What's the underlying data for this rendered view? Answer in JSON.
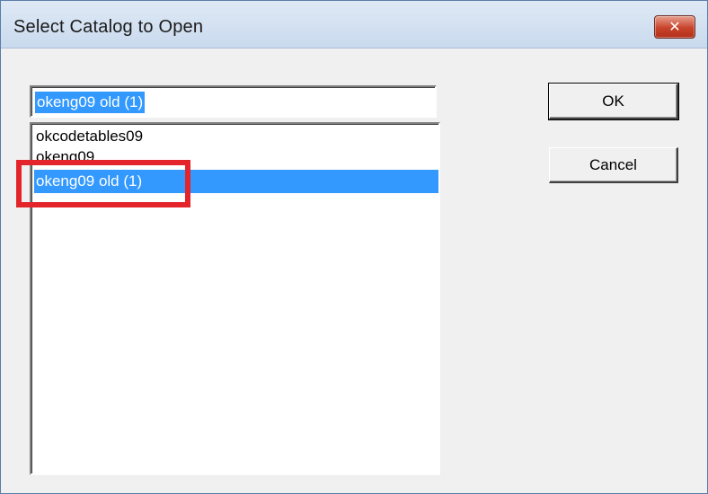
{
  "window": {
    "title": "Select Catalog to Open",
    "close_glyph": "✕"
  },
  "edit": {
    "value": "okeng09 old (1)"
  },
  "list": {
    "items": [
      {
        "label": "okcodetables09",
        "selected": false
      },
      {
        "label": "okeng09",
        "selected": false
      },
      {
        "label": "okeng09 old (1)",
        "selected": true
      }
    ]
  },
  "buttons": {
    "ok_label": "OK",
    "cancel_label": "Cancel"
  },
  "colors": {
    "selection": "#3399ff",
    "highlight_annotation": "#e3242b",
    "close_button": "#c7432b"
  }
}
